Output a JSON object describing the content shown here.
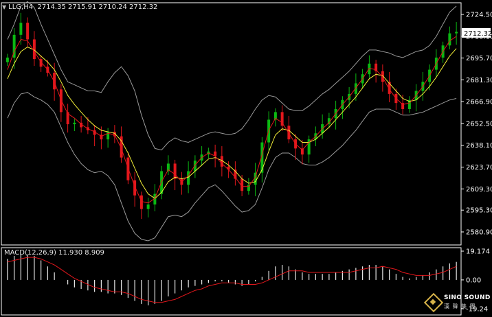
{
  "chart_data": [
    {
      "type": "candlestick",
      "symbol": "LLG",
      "timeframe": "H4",
      "header": "LLG,H4  2714.35 2715.91 2710.24 2712.32",
      "ohlc": {
        "open": 2714.35,
        "high": 2715.91,
        "low": 2710.24,
        "close": 2712.32
      },
      "current_price": "2712.32",
      "y_ticks": [
        "2724.50",
        "2710.10",
        "2695.70",
        "2681.30",
        "2666.90",
        "2652.50",
        "2638.10",
        "2623.70",
        "2609.30",
        "2595.30",
        "2580.90"
      ],
      "ylim": [
        2580.9,
        2724.5
      ],
      "close_path": [
        2696,
        2711,
        2719,
        2708,
        2695,
        2690,
        2686,
        2675,
        2660,
        2652,
        2653,
        2650,
        2648,
        2645,
        2642,
        2647,
        2644,
        2630,
        2615,
        2605,
        2596,
        2599,
        2606,
        2621,
        2626,
        2616,
        2612,
        2621,
        2628,
        2632,
        2634,
        2631,
        2624,
        2622,
        2616,
        2608,
        2612,
        2620,
        2640,
        2655,
        2660,
        2651,
        2642,
        2636,
        2632,
        2642,
        2646,
        2652,
        2656,
        2662,
        2668,
        2672,
        2679,
        2685,
        2692,
        2687,
        2680,
        2672,
        2666,
        2662,
        2668,
        2674,
        2680,
        2688,
        2696,
        2704,
        2712,
        2713
      ],
      "ma_fast": [
        2688,
        2700,
        2708,
        2707,
        2700,
        2693,
        2688,
        2680,
        2668,
        2659,
        2656,
        2652,
        2649,
        2647,
        2644,
        2646,
        2645,
        2636,
        2623,
        2611,
        2601,
        2600,
        2603,
        2614,
        2622,
        2619,
        2614,
        2618,
        2625,
        2630,
        2633,
        2631,
        2626,
        2622,
        2617,
        2611,
        2611,
        2617,
        2632,
        2648,
        2656,
        2653,
        2646,
        2639,
        2635,
        2640,
        2644,
        2649,
        2653,
        2659,
        2665,
        2670,
        2676,
        2682,
        2689,
        2688,
        2683,
        2675,
        2669,
        2665,
        2666,
        2671,
        2677,
        2684,
        2692,
        2700,
        2707,
        2710
      ],
      "ma_slow": [
        2682,
        2692,
        2700,
        2703,
        2701,
        2697,
        2693,
        2688,
        2680,
        2671,
        2665,
        2660,
        2655,
        2651,
        2648,
        2647,
        2646,
        2641,
        2633,
        2623,
        2613,
        2606,
        2603,
        2607,
        2614,
        2617,
        2616,
        2617,
        2621,
        2625,
        2629,
        2630,
        2628,
        2625,
        2621,
        2616,
        2613,
        2614,
        2622,
        2634,
        2645,
        2649,
        2648,
        2644,
        2640,
        2640,
        2642,
        2646,
        2650,
        2655,
        2660,
        2665,
        2670,
        2676,
        2682,
        2685,
        2684,
        2679,
        2674,
        2669,
        2667,
        2668,
        2672,
        2677,
        2683,
        2690,
        2697,
        2702
      ],
      "bollinger_upper": [
        2708,
        2718,
        2730,
        2733,
        2729,
        2718,
        2708,
        2698,
        2688,
        2680,
        2678,
        2676,
        2674,
        2674,
        2673,
        2680,
        2686,
        2690,
        2684,
        2674,
        2658,
        2645,
        2636,
        2635,
        2640,
        2643,
        2641,
        2640,
        2642,
        2644,
        2646,
        2647,
        2646,
        2645,
        2646,
        2649,
        2655,
        2662,
        2668,
        2671,
        2670,
        2666,
        2662,
        2661,
        2661,
        2664,
        2668,
        2672,
        2675,
        2679,
        2683,
        2687,
        2692,
        2697,
        2701,
        2701,
        2700,
        2699,
        2697,
        2696,
        2698,
        2700,
        2701,
        2704,
        2710,
        2718,
        2726,
        2730
      ],
      "bollinger_lower": [
        2656,
        2666,
        2672,
        2673,
        2670,
        2668,
        2665,
        2660,
        2650,
        2640,
        2632,
        2626,
        2622,
        2620,
        2621,
        2618,
        2612,
        2600,
        2588,
        2580,
        2576,
        2575,
        2577,
        2584,
        2591,
        2592,
        2591,
        2594,
        2600,
        2605,
        2610,
        2612,
        2608,
        2603,
        2598,
        2594,
        2595,
        2599,
        2610,
        2622,
        2630,
        2633,
        2633,
        2630,
        2626,
        2625,
        2625,
        2627,
        2630,
        2634,
        2638,
        2643,
        2648,
        2654,
        2660,
        2662,
        2662,
        2662,
        2660,
        2658,
        2658,
        2659,
        2660,
        2662,
        2664,
        2666,
        2668,
        2669
      ]
    },
    {
      "type": "macd",
      "name": "MACD(12,26,9)",
      "header": "MACD(12,26,9) 11.930 8.909",
      "macd": 11.93,
      "signal": 8.909,
      "y_ticks": [
        "19.174",
        "0.00",
        "-19.24"
      ],
      "ylim": [
        -19.24,
        19.174
      ],
      "histogram": [
        14,
        16,
        17,
        17,
        16,
        13,
        9,
        5,
        0,
        -3,
        -5,
        -6,
        -7,
        -8,
        -8,
        -9,
        -9,
        -10,
        -12,
        -14,
        -16,
        -17,
        -16,
        -14,
        -11,
        -9,
        -7,
        -5,
        -4,
        -3,
        -2,
        -1,
        -1,
        -2,
        -3,
        -4,
        -3,
        -1,
        2,
        6,
        9,
        10,
        9,
        7,
        5,
        4,
        4,
        4,
        4,
        5,
        6,
        7,
        8,
        9,
        10,
        10,
        9,
        7,
        4,
        2,
        1,
        2,
        3,
        5,
        7,
        9,
        11,
        12
      ],
      "signal_line": [
        12,
        13,
        14,
        15,
        15,
        14,
        12,
        10,
        7,
        4,
        1,
        -1,
        -3,
        -5,
        -6,
        -7,
        -8,
        -8,
        -9,
        -11,
        -13,
        -14,
        -15,
        -15,
        -14,
        -13,
        -11,
        -9,
        -7,
        -6,
        -4,
        -3,
        -2,
        -2,
        -2,
        -3,
        -3,
        -3,
        -2,
        0,
        2,
        4,
        6,
        6,
        6,
        5,
        5,
        5,
        5,
        5,
        5,
        5,
        6,
        7,
        8,
        8,
        9,
        8,
        7,
        5,
        4,
        3,
        3,
        3,
        4,
        5,
        7,
        9
      ]
    }
  ],
  "brand": {
    "name": "SINO SOUND",
    "subtitle": "漢 聲 集 團"
  },
  "colors": {
    "background": "#000000",
    "bull_candle": "#0bb812",
    "bear_candle": "#e3171c",
    "ma_fast": "#e3171c",
    "ma_slow": "#f2ee38",
    "bollinger": "#9a9a9a",
    "macd_histogram": "#e8e8e8",
    "signal_line": "#e3171c",
    "axis": "#ffffff",
    "grid_text": "#ffffff"
  }
}
